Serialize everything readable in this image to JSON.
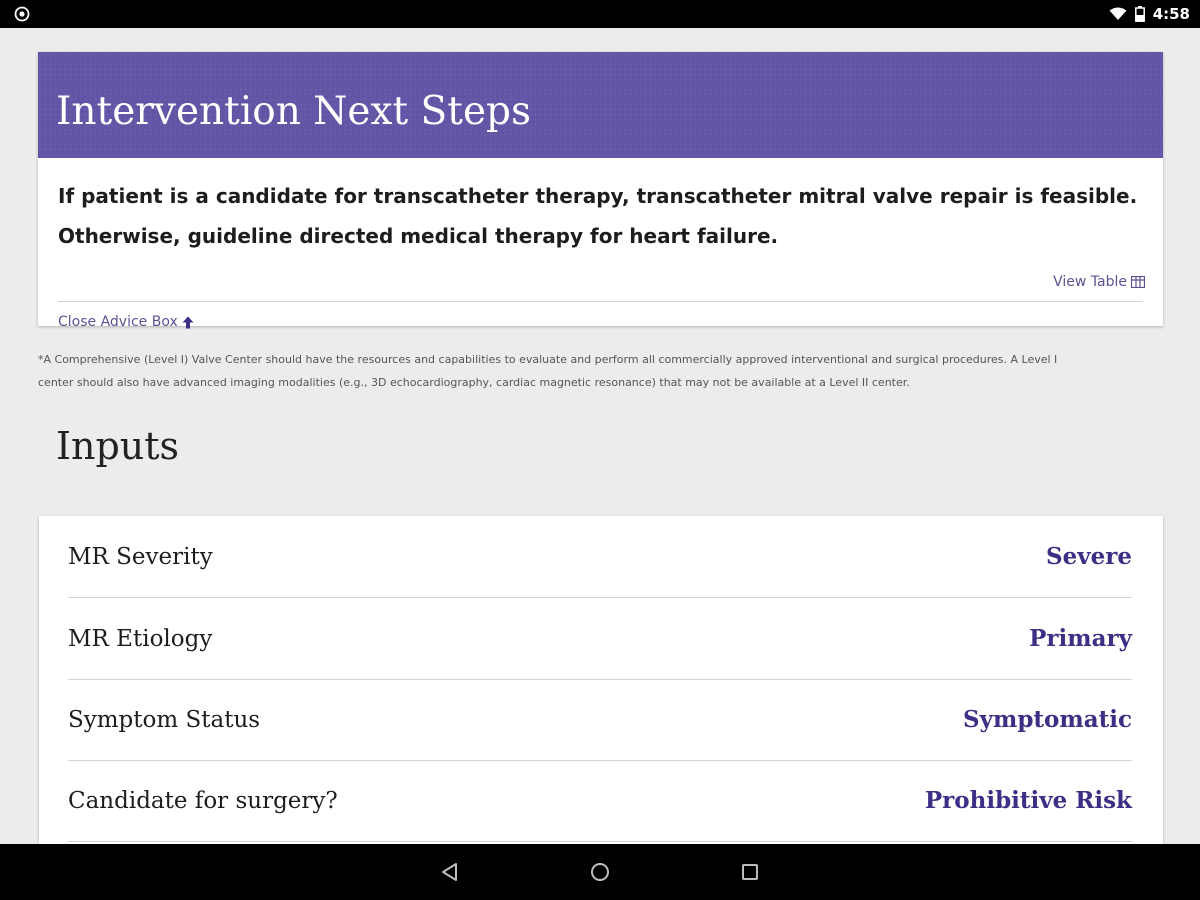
{
  "status_bar": {
    "time": "4:58",
    "left_icon": "settings-circle-icon",
    "wifi_icon": "wifi-icon",
    "battery_icon": "battery-icon"
  },
  "advice": {
    "title": "Intervention Next Steps",
    "lines": [
      "If patient is a candidate for transcatheter therapy, transcatheter mitral valve repair is feasible.",
      "Otherwise, guideline directed medical therapy for heart failure."
    ],
    "view_table_label": "View Table",
    "close_label": "Close Advice Box"
  },
  "footnote": {
    "line1": "*A Comprehensive (Level I) Valve Center should have the resources and capabilities to evaluate and perform all commercially approved interventional and surgical procedures. A Level I",
    "line2": "center should also have advanced imaging modalities (e.g., 3D echocardiography, cardiac magnetic resonance) that may not be available at a Level II center."
  },
  "inputs": {
    "heading": "Inputs",
    "rows": [
      {
        "label": "MR Severity",
        "value": "Severe"
      },
      {
        "label": "MR Etiology",
        "value": "Primary"
      },
      {
        "label": "Symptom Status",
        "value": "Symptomatic"
      },
      {
        "label": "Candidate for surgery?",
        "value": "Prohibitive Risk"
      }
    ]
  },
  "colors": {
    "header_purple": "#6355a6",
    "value_purple": "#3b2f86",
    "link_purple": "#5a5393"
  },
  "nav_bar": {
    "back_icon": "back-icon",
    "home_icon": "home-icon",
    "recents_icon": "recents-icon"
  }
}
